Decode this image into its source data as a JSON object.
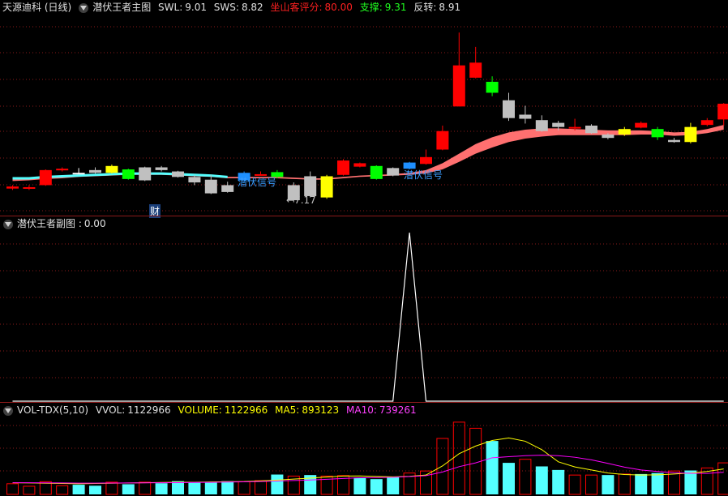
{
  "main": {
    "stock_name": "天源迪科 (日线)",
    "indicator": "潜伏王者主图",
    "swl_label": "SWL:",
    "swl_value": "9.01",
    "sws_label": "SWS:",
    "sws_value": "8.82",
    "score_label": "坐山客评分:",
    "score_value": "80.00",
    "support_label": "支撑:",
    "support_value": "9.31",
    "reverse_label": "反转:",
    "reverse_value": "8.91",
    "signal_label_1": "潜伏信号",
    "signal_label_2": "潜伏信号",
    "low_marker": "←7.17",
    "finance_badge": "财"
  },
  "sub": {
    "indicator": "潜伏王者副图 :",
    "value": "0.00"
  },
  "vol": {
    "indicator": "VOL-TDX(5,10)",
    "vvol_label": "VVOL:",
    "vvol_value": "1122966",
    "volume_label": "VOLUME:",
    "volume_value": "1122966",
    "ma5_label": "MA5:",
    "ma5_value": "893123",
    "ma10_label": "MA10:",
    "ma10_value": "739261"
  },
  "colors": {
    "up": "#ff0000",
    "down_cyan": "#54ffff",
    "white": "#ffffff",
    "yellow": "#ffff00",
    "magenta": "#ff00ff",
    "green": "#00ff00",
    "blue": "#1e90ff",
    "gray": "#c0c0c0",
    "grid": "#8b1a1a",
    "ribbon": "#ff7070"
  },
  "candles": [
    {
      "o": 8.35,
      "c": 8.38,
      "h": 8.4,
      "l": 8.33,
      "col": "red"
    },
    {
      "o": 8.37,
      "c": 8.35,
      "h": 8.4,
      "l": 8.33,
      "col": "red"
    },
    {
      "o": 8.4,
      "c": 8.62,
      "h": 8.63,
      "l": 8.39,
      "col": "red"
    },
    {
      "o": 8.62,
      "c": 8.64,
      "h": 8.66,
      "l": 8.6,
      "col": "red"
    },
    {
      "o": 8.58,
      "c": 8.58,
      "h": 8.65,
      "l": 8.56,
      "col": "white"
    },
    {
      "o": 8.58,
      "c": 8.62,
      "h": 8.66,
      "l": 8.57,
      "col": "gray"
    },
    {
      "o": 8.58,
      "c": 8.68,
      "h": 8.7,
      "l": 8.57,
      "col": "yellow"
    },
    {
      "o": 8.63,
      "c": 8.49,
      "h": 8.64,
      "l": 8.48,
      "col": "green"
    },
    {
      "o": 8.66,
      "c": 8.47,
      "h": 8.67,
      "l": 8.46,
      "col": "gray"
    },
    {
      "o": 8.66,
      "c": 8.62,
      "h": 8.68,
      "l": 8.6,
      "col": "gray"
    },
    {
      "o": 8.6,
      "c": 8.52,
      "h": 8.61,
      "l": 8.51,
      "col": "gray"
    },
    {
      "o": 8.52,
      "c": 8.44,
      "h": 8.55,
      "l": 8.4,
      "col": "gray"
    },
    {
      "o": 8.48,
      "c": 8.28,
      "h": 8.55,
      "l": 8.27,
      "col": "gray"
    },
    {
      "o": 8.4,
      "c": 8.3,
      "h": 8.45,
      "l": 8.29,
      "col": "gray"
    },
    {
      "o": 8.58,
      "c": 8.47,
      "h": 8.6,
      "l": 8.46,
      "col": "blue"
    },
    {
      "o": 8.56,
      "c": 8.56,
      "h": 8.6,
      "l": 8.54,
      "col": "red"
    },
    {
      "o": 8.59,
      "c": 8.52,
      "h": 8.62,
      "l": 8.5,
      "col": "green"
    },
    {
      "o": 8.4,
      "c": 8.18,
      "h": 8.44,
      "l": 8.15,
      "col": "gray"
    },
    {
      "o": 8.24,
      "c": 8.53,
      "h": 8.6,
      "l": 8.22,
      "col": "gray"
    },
    {
      "o": 8.22,
      "c": 8.53,
      "h": 8.55,
      "l": 8.2,
      "col": "yellow"
    },
    {
      "o": 8.55,
      "c": 8.76,
      "h": 8.78,
      "l": 8.54,
      "col": "red"
    },
    {
      "o": 8.67,
      "c": 8.72,
      "h": 8.73,
      "l": 8.66,
      "col": "red"
    },
    {
      "o": 8.49,
      "c": 8.68,
      "h": 8.69,
      "l": 8.48,
      "col": "green"
    },
    {
      "o": 8.65,
      "c": 8.54,
      "h": 8.66,
      "l": 8.53,
      "col": "gray"
    },
    {
      "o": 8.64,
      "c": 8.73,
      "h": 8.74,
      "l": 8.63,
      "col": "blue"
    },
    {
      "o": 8.71,
      "c": 8.81,
      "h": 8.92,
      "l": 8.7,
      "col": "red"
    },
    {
      "o": 8.92,
      "c": 9.19,
      "h": 9.27,
      "l": 8.91,
      "col": "red"
    },
    {
      "o": 9.55,
      "c": 10.15,
      "h": 10.63,
      "l": 9.55,
      "col": "red"
    },
    {
      "o": 9.97,
      "c": 10.19,
      "h": 10.42,
      "l": 9.96,
      "col": "red"
    },
    {
      "o": 9.91,
      "c": 9.75,
      "h": 9.99,
      "l": 9.7,
      "col": "green"
    },
    {
      "o": 9.64,
      "c": 9.38,
      "h": 9.75,
      "l": 9.34,
      "col": "gray"
    },
    {
      "o": 9.43,
      "c": 9.37,
      "h": 9.56,
      "l": 9.3,
      "col": "gray"
    },
    {
      "o": 9.35,
      "c": 9.19,
      "h": 9.42,
      "l": 9.18,
      "col": "gray"
    },
    {
      "o": 9.31,
      "c": 9.25,
      "h": 9.34,
      "l": 9.2,
      "col": "gray"
    },
    {
      "o": 9.25,
      "c": 9.25,
      "h": 9.37,
      "l": 9.2,
      "col": "red"
    },
    {
      "o": 9.27,
      "c": 9.16,
      "h": 9.29,
      "l": 9.15,
      "col": "gray"
    },
    {
      "o": 9.14,
      "c": 9.09,
      "h": 9.16,
      "l": 9.07,
      "col": "gray"
    },
    {
      "o": 9.14,
      "c": 9.22,
      "h": 9.25,
      "l": 9.12,
      "col": "yellow"
    },
    {
      "o": 9.24,
      "c": 9.31,
      "h": 9.33,
      "l": 9.23,
      "col": "red"
    },
    {
      "o": 9.22,
      "c": 9.1,
      "h": 9.25,
      "l": 9.06,
      "col": "green"
    },
    {
      "o": 9.06,
      "c": 9.03,
      "h": 9.09,
      "l": 9.02,
      "col": "gray"
    },
    {
      "o": 9.25,
      "c": 9.03,
      "h": 9.31,
      "l": 9.01,
      "col": "yellow"
    },
    {
      "o": 9.28,
      "c": 9.35,
      "h": 9.38,
      "l": 9.26,
      "col": "red"
    },
    {
      "o": 9.36,
      "c": 9.59,
      "h": 9.6,
      "l": 9.27,
      "col": "red"
    }
  ],
  "ribbon_upper": [
    8.5,
    8.5,
    8.52,
    8.53,
    8.54,
    8.55,
    8.56,
    8.57,
    8.57,
    8.57,
    8.56,
    8.55,
    8.54,
    8.52,
    8.52,
    8.52,
    8.52,
    8.51,
    8.5,
    8.5,
    8.52,
    8.54,
    8.55,
    8.56,
    8.58,
    8.62,
    8.72,
    8.86,
    9.0,
    9.1,
    9.17,
    9.21,
    9.23,
    9.23,
    9.22,
    9.21,
    9.2,
    9.2,
    9.2,
    9.19,
    9.17,
    9.18,
    9.22,
    9.28
  ],
  "ribbon_lower": [
    8.46,
    8.47,
    8.49,
    8.5,
    8.52,
    8.53,
    8.54,
    8.55,
    8.55,
    8.55,
    8.54,
    8.53,
    8.52,
    8.5,
    8.5,
    8.5,
    8.5,
    8.49,
    8.48,
    8.48,
    8.5,
    8.52,
    8.53,
    8.54,
    8.55,
    8.57,
    8.63,
    8.74,
    8.86,
    8.95,
    9.03,
    9.08,
    9.11,
    9.13,
    9.13,
    9.13,
    9.13,
    9.13,
    9.14,
    9.14,
    9.12,
    9.13,
    9.16,
    9.21
  ],
  "sub_series": [
    0,
    0,
    0,
    0,
    0,
    0,
    0,
    0,
    0,
    0,
    0,
    0,
    0,
    0,
    0,
    0,
    0,
    0,
    0,
    0,
    0,
    0,
    0,
    0,
    1,
    0,
    0,
    0,
    0,
    0,
    0,
    0,
    0,
    0,
    0,
    0,
    0,
    0,
    0,
    0,
    0,
    0,
    0,
    0
  ],
  "volumes": [
    {
      "v": 210000,
      "up": true
    },
    {
      "v": 160000,
      "up": true
    },
    {
      "v": 250000,
      "up": true
    },
    {
      "v": 170000,
      "up": true
    },
    {
      "v": 190000,
      "up": false
    },
    {
      "v": 170000,
      "up": false
    },
    {
      "v": 240000,
      "up": true
    },
    {
      "v": 200000,
      "up": false
    },
    {
      "v": 240000,
      "up": true
    },
    {
      "v": 220000,
      "up": false
    },
    {
      "v": 260000,
      "up": false
    },
    {
      "v": 230000,
      "up": false
    },
    {
      "v": 230000,
      "up": false
    },
    {
      "v": 260000,
      "up": false
    },
    {
      "v": 250000,
      "up": true
    },
    {
      "v": 270000,
      "up": true
    },
    {
      "v": 390000,
      "up": false
    },
    {
      "v": 360000,
      "up": true
    },
    {
      "v": 380000,
      "up": false
    },
    {
      "v": 360000,
      "up": true
    },
    {
      "v": 370000,
      "up": true
    },
    {
      "v": 330000,
      "up": false
    },
    {
      "v": 300000,
      "up": false
    },
    {
      "v": 350000,
      "up": false
    },
    {
      "v": 420000,
      "up": true
    },
    {
      "v": 460000,
      "up": true
    },
    {
      "v": 1100000,
      "up": true
    },
    {
      "v": 1420000,
      "up": true
    },
    {
      "v": 1300000,
      "up": true
    },
    {
      "v": 1050000,
      "up": false
    },
    {
      "v": 620000,
      "up": false
    },
    {
      "v": 690000,
      "up": true
    },
    {
      "v": 550000,
      "up": false
    },
    {
      "v": 480000,
      "up": false
    },
    {
      "v": 380000,
      "up": true
    },
    {
      "v": 380000,
      "up": true
    },
    {
      "v": 380000,
      "up": false
    },
    {
      "v": 400000,
      "up": true
    },
    {
      "v": 400000,
      "up": false
    },
    {
      "v": 420000,
      "up": false
    },
    {
      "v": 460000,
      "up": true
    },
    {
      "v": 470000,
      "up": false
    },
    {
      "v": 520000,
      "up": true
    },
    {
      "v": 620000,
      "up": true
    }
  ],
  "ma5": [
    230000,
    225000,
    220000,
    215000,
    210000,
    215000,
    220000,
    225000,
    230000,
    235000,
    240000,
    240000,
    245000,
    248000,
    252000,
    265000,
    280000,
    300000,
    320000,
    340000,
    360000,
    362000,
    352000,
    345000,
    355000,
    380000,
    560000,
    800000,
    950000,
    1060000,
    1110000,
    1045000,
    880000,
    640000,
    540000,
    480000,
    420000,
    390000,
    380000,
    385000,
    400000,
    420000,
    450000,
    500000
  ],
  "ma10": [
    230000,
    230000,
    228000,
    225000,
    222000,
    222000,
    224000,
    226000,
    228000,
    230000,
    232000,
    235000,
    238000,
    242000,
    246000,
    252000,
    262000,
    272000,
    282000,
    296000,
    312000,
    326000,
    330000,
    336000,
    350000,
    368000,
    440000,
    545000,
    620000,
    720000,
    740000,
    760000,
    770000,
    760000,
    730000,
    680000,
    610000,
    535000,
    480000,
    450000,
    425000,
    415000,
    412000,
    435000
  ]
}
